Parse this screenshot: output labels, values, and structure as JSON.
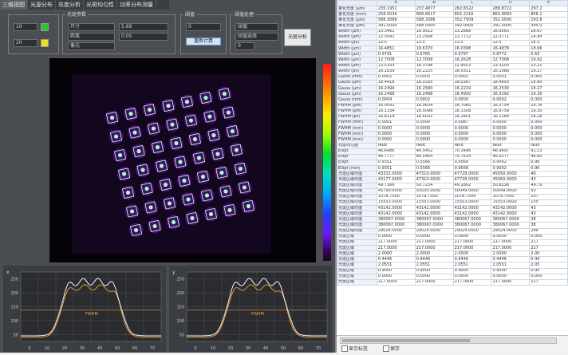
{
  "tabs": [
    "三维视图",
    "光源分布",
    "灰度分析",
    "光斑均匀性",
    "功率分布测量"
  ],
  "controls": {
    "top_values": [
      "10",
      "20"
    ],
    "group2_title": "光斑参数",
    "group2_rows": [
      "尺寸",
      "距离",
      "像元"
    ],
    "group2_values": [
      "5.69",
      "0.05"
    ],
    "group3_title": "阈值",
    "group3_value": "0",
    "group3_button": "重新计算",
    "group4_title": "阈值处理",
    "group4_rows": [
      "阈值",
      "阈值选择"
    ],
    "group4_value": "0",
    "analyze_button": "光斑分析"
  },
  "table": {
    "columns": [
      "",
      "A",
      "B",
      "C",
      "D",
      "E"
    ],
    "rows": [
      [
        "",
        "A",
        "B",
        "C",
        "D",
        "E"
      ],
      [
        "量化光斑 (µm)",
        "235.1951",
        "237.4877",
        "282.6522",
        "288.8722",
        "297.2"
      ],
      [
        "量化光斑 (mm)",
        "258.5036",
        "866.6617",
        "892.2216",
        "863.9093",
        "856.1"
      ],
      [
        "量化光斑 (µm)",
        "588.3086",
        "588.2086",
        "352.7509",
        "352.0000",
        "293.8"
      ],
      [
        "量化光斑 (µm)",
        "391.0000",
        "588.0000",
        "392.0000",
        "391.0000",
        "395.0"
      ],
      [
        "Width (µm)",
        "13.3461",
        "16.9512",
        "13.2868",
        "16.9565",
        "16.67"
      ],
      [
        "Width (µm)",
        "12.5091",
        "13.2568",
        "12.7712",
        "12.3771",
        "14.94"
      ],
      [
        "Width (px)",
        "13.5",
        "13.5",
        "13.5",
        "12.5",
        "16.5"
      ],
      [
        "Width (µm)",
        "16.4851",
        "18.6370",
        "16.0398",
        "16.4878",
        "18.66"
      ],
      [
        "Width (µm)",
        "0.9791",
        "0.5765",
        "0.9797",
        "0.8772",
        "0.63"
      ],
      [
        "Width (µm)",
        "12.7008",
        "12.7008",
        "16.2628",
        "12.7008",
        "16.92"
      ],
      [
        "Width (µm)",
        "13.5333",
        "16.3798",
        "12.9503",
        "13.3205",
        "15.21"
      ],
      [
        "Width (px)",
        "16.1839",
        "16.2225",
        "16.0311",
        "16.1068",
        "16.27"
      ],
      [
        "Gauss (mm)",
        "0.0002",
        "0.0003",
        "0.0002",
        "0.0001",
        "0.000"
      ],
      [
        "Gauss (µm)",
        "18.4418",
        "18.0335",
        "18.0387",
        "18.4893",
        "16.80"
      ],
      [
        "Gauss (µm)",
        "16.2494",
        "16.2580",
        "16.2219",
        "16.2530",
        "16.27"
      ],
      [
        "Gauss (µm)",
        "16.2498",
        "16.2498",
        "16.4930",
        "16.3292",
        "16.30"
      ],
      [
        "Gauss (mm)",
        "0.0004",
        "0.0002",
        "0.0000",
        "0.0002",
        "0.000"
      ],
      [
        "FWHM (µm)",
        "16.0591",
        "16.0634",
        "16.7060",
        "16.2754",
        "16.76"
      ],
      [
        "FWHM (µm)",
        "16.1334",
        "16.5098",
        "16.1508",
        "16.8759",
        "16.30"
      ],
      [
        "FWHM (px)",
        "16.6119",
        "16.4031",
        "16.2401",
        "16.1266",
        "16.28"
      ],
      [
        "FWHM (mm)",
        "0.0001",
        "0.0000",
        "0.0087",
        "0.0000",
        "0.000"
      ],
      [
        "FWHM (mm)",
        "0.0000",
        "0.0000",
        "0.0000",
        "0.0000",
        "0.000"
      ],
      [
        "FWHM (mm)",
        "0.0000",
        "0.0000",
        "0.0000",
        "0.0000",
        "0.000"
      ],
      [
        "FWHM (mm)",
        "0.0000",
        "0.0000",
        "0.0000",
        "0.0000",
        "0.000"
      ],
      [
        "光斑均匀度",
        "fault",
        "fault",
        "fault",
        "fault",
        "fault"
      ],
      [
        "Ellipt",
        "46.6486",
        "46.5452",
        "70.3496",
        "46.9497",
        "91.13"
      ],
      [
        "Ellipt",
        "46.7777",
        "46.5464",
        "70.7634",
        "46.6277",
        "46.80"
      ],
      [
        "Ellipt",
        "0.9351",
        "0.5566",
        "0.9568",
        "0.9562",
        "0.96"
      ],
      [
        "Ellipt (mm)",
        "0.9351",
        "0.5566",
        "0.9568",
        "0.9562",
        "0.96"
      ],
      [
        "光斑区域均值",
        "43332.0000",
        "47510.0000",
        "47728.0000",
        "45050.0000",
        "40"
      ],
      [
        "光斑区域均值",
        "43177.0000",
        "47310.0000",
        "47728.0000",
        "45060.0000",
        "43"
      ],
      [
        "光斑区域均值",
        "49.7366",
        "50.7234",
        "49.2802",
        "50.8236",
        "49.79"
      ],
      [
        "光斑区域均值",
        "45790.0000",
        "55030.0000",
        "50049.0000",
        "50049.0000",
        "50"
      ],
      [
        "光斑区域均值",
        "1078.7500",
        "1079.7500",
        "1078.7500",
        "1079.7500",
        "107"
      ],
      [
        "光斑区域均值",
        "15553.0000",
        "15553.0000",
        "15553.0000",
        "15553.0000",
        "155"
      ],
      [
        "光斑区域均值",
        "43142.0000",
        "43142.0000",
        "43142.0000",
        "43142.0000",
        "43"
      ],
      [
        "光斑区域均值",
        "43142.0000",
        "43142.0000",
        "43142.0000",
        "43142.0000",
        "43"
      ],
      [
        "光斑区域均值",
        "380067.0000",
        "380067.0000",
        "380067.0000",
        "380067.0000",
        "38"
      ],
      [
        "光斑区域均值",
        "380067.0000",
        "380067.0000",
        "380067.0000",
        "380067.0000",
        "38"
      ],
      [
        "光斑区域均值",
        "29024.0000",
        "29024.0000",
        "29024.0000",
        "29024.0000",
        "290"
      ],
      [
        "光斑区域",
        "0.0000",
        "0.0000",
        "0.0000",
        "0.0000",
        "0.000"
      ],
      [
        "光斑区域",
        "217.0000",
        "217.0000",
        "217.0000",
        "217.0000",
        "217"
      ],
      [
        "光斑区域",
        "217.0000",
        "217.0000",
        "217.0000",
        "217.0000",
        "217"
      ],
      [
        "光斑区域",
        "2.0000",
        "2.0000",
        "2.0000",
        "2.0000",
        "2.00"
      ],
      [
        "光斑区域",
        "0.4446",
        "0.4446",
        "0.4446",
        "0.4446",
        "0.44"
      ],
      [
        "光斑区域",
        "2.0551",
        "2.0551",
        "2.0551",
        "2.0551",
        "2.05"
      ],
      [
        "光斑区域",
        "0.9000",
        "0.9000",
        "0.9000",
        "0.9000",
        "0.90"
      ],
      [
        "光斑区域",
        "0.0000",
        "0.0000",
        "0.0000",
        "0.0000",
        "0.000"
      ],
      [
        "光斑区域",
        "217.0000",
        "217.0000",
        "217.0000",
        "217.0000",
        "217"
      ]
    ]
  },
  "bottom": {
    "check1": "显示标签",
    "check2": "保存"
  },
  "plots": {
    "left": {
      "title": "x",
      "yticks": [
        "250",
        "200",
        "150",
        "100",
        "50"
      ],
      "xticks": [
        "0",
        "10",
        "20",
        "30",
        "40",
        "50",
        "60",
        "70"
      ],
      "annotation": "FWHM"
    },
    "right": {
      "title": "y",
      "yticks": [
        "250",
        "200",
        "150",
        "100",
        "50"
      ],
      "xticks": [
        "0",
        "10",
        "20",
        "30",
        "40",
        "50",
        "60",
        "70"
      ],
      "annotation": "FWHM"
    }
  },
  "colors": {
    "spot_box": "#f4f4f4",
    "spot_core": "#a8ffb8",
    "curve_white": "#f5f5f5",
    "curve_orange": "#f0a040"
  }
}
